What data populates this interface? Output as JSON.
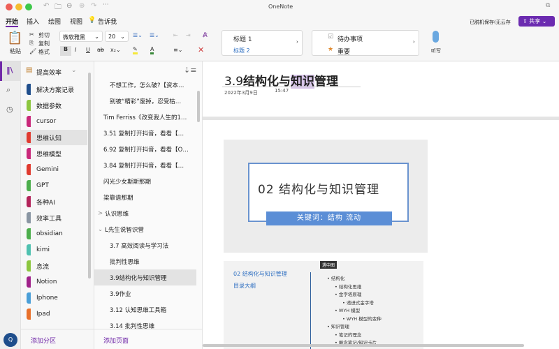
{
  "window": {
    "title": "OneNote"
  },
  "menu_tabs": [
    "开始",
    "插入",
    "绘图",
    "视图",
    "告诉我"
  ],
  "ribbon": {
    "paste": "粘贴",
    "cut": "剪切",
    "copy": "复制",
    "format": "格式",
    "font": "微软雅黑",
    "size": "20",
    "styles": [
      "标题 1",
      "标题 2"
    ],
    "tags": [
      "待办事项",
      "重要"
    ],
    "dictate": "听写",
    "save_status": "已脱机保存(无云存",
    "share": "共享"
  },
  "notebook": {
    "name": "提高效率"
  },
  "sections": [
    {
      "label": "解决方案记录",
      "color": "#1f4e8c"
    },
    {
      "label": "数据参数",
      "color": "#8cc63f"
    },
    {
      "label": "cursor",
      "color": "#c9287a"
    },
    {
      "label": "思维认知",
      "color": "#e03a2f",
      "selected": true
    },
    {
      "label": "思维模型",
      "color": "#c9287a"
    },
    {
      "label": "Gemini",
      "color": "#e03a2f"
    },
    {
      "label": "GPT",
      "color": "#4cae4c"
    },
    {
      "label": "各种AI",
      "color": "#b3245a"
    },
    {
      "label": "效率工具",
      "color": "#8a96a3"
    },
    {
      "label": "obsidian",
      "color": "#4cae4c"
    },
    {
      "label": "kimi",
      "color": "#4fc1b0"
    },
    {
      "label": "息流",
      "color": "#8cc63f"
    },
    {
      "label": "Notion",
      "color": "#a0228a"
    },
    {
      "label": "Iphone",
      "color": "#4a9fd8"
    },
    {
      "label": "Ipad",
      "color": "#e8702a"
    }
  ],
  "add_section": "添加分区",
  "pages": [
    {
      "label": "不想工作，怎么破?【资本…",
      "indent": 2
    },
    {
      "label": "别被“精彩”废掉，忍受枯…",
      "indent": 2
    },
    {
      "label": "Tim Ferriss《改变我人生的1…",
      "indent": 1
    },
    {
      "label": "3.51 复制打开抖音，看看【…",
      "indent": 1
    },
    {
      "label": "6.92 复制打开抖音，看看【O…",
      "indent": 1
    },
    {
      "label": "3.84 复制打开抖音，看看【…",
      "indent": 1
    },
    {
      "label": "闪光少女斯斯那期",
      "indent": 1
    },
    {
      "label": "梁靠谱那期",
      "indent": 1
    },
    {
      "label": "认识思维",
      "indent": 0,
      "arrow": ">"
    },
    {
      "label": "L先生说智识营",
      "indent": 0,
      "arrow": "⌄"
    },
    {
      "label": "3.7 高效阅读与学习法",
      "indent": 2
    },
    {
      "label": "批判性思维",
      "indent": 2
    },
    {
      "label": "3.9结构化与知识管理",
      "indent": 2,
      "selected": true
    },
    {
      "label": "3.9作业",
      "indent": 2
    },
    {
      "label": "3.12 认知思维工具箱",
      "indent": 2
    },
    {
      "label": "3.14 批判性思维",
      "indent": 2
    }
  ],
  "add_page": "添加页面",
  "note": {
    "title_prefix": "3.9",
    "title_bold": "结构化与",
    "title_hl": "知识",
    "title_rest": "管理",
    "date": "2022年3月9日",
    "time": "15:47",
    "slide": {
      "title": "02  结构化与知识管理",
      "keywords": "关键词：结构   流动"
    },
    "outline": {
      "heading": "02 结构化与知识管理",
      "sub": "目录大纲",
      "badge": "遇中图",
      "items": [
        {
          "t": "结构化",
          "l": 0
        },
        {
          "t": "结构化思维",
          "l": 1
        },
        {
          "t": "金字塔原理",
          "l": 1
        },
        {
          "t": "递进式金字塔",
          "l": 2
        },
        {
          "t": "WYH 模型",
          "l": 1
        },
        {
          "t": "WYH 模型的变种",
          "l": 2
        },
        {
          "t": "知识管理",
          "l": 0
        },
        {
          "t": "笔记的理念",
          "l": 1
        },
        {
          "t": "概念笔记/知识卡片",
          "l": 1
        }
      ]
    }
  },
  "avatar": "Q",
  "colors": {
    "accent": "#7028a8",
    "share": "#6b2bb0",
    "link": "#2e6fc1"
  }
}
